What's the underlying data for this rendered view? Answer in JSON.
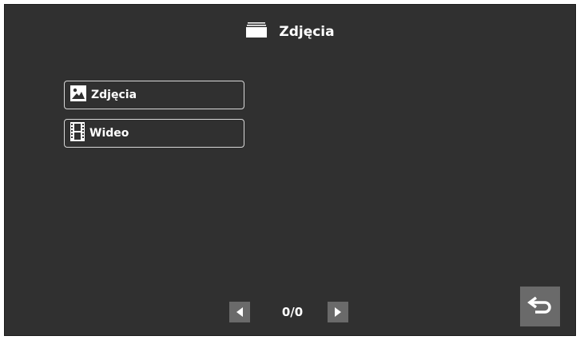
{
  "header": {
    "title": "Zdjęcia",
    "icon": "folder-stack-icon"
  },
  "menu": {
    "items": [
      {
        "label": "Zdjęcia",
        "icon": "image-icon"
      },
      {
        "label": "Wideo",
        "icon": "film-icon"
      }
    ]
  },
  "pagination": {
    "counter": "0/0",
    "prev_icon": "triangle-left-icon",
    "next_icon": "triangle-right-icon"
  },
  "back_button": {
    "icon": "return-arrow-icon"
  },
  "colors": {
    "background": "#303030",
    "button_gray": "#6a6a6a",
    "border": "#d8d8d8",
    "text": "#ffffff"
  }
}
